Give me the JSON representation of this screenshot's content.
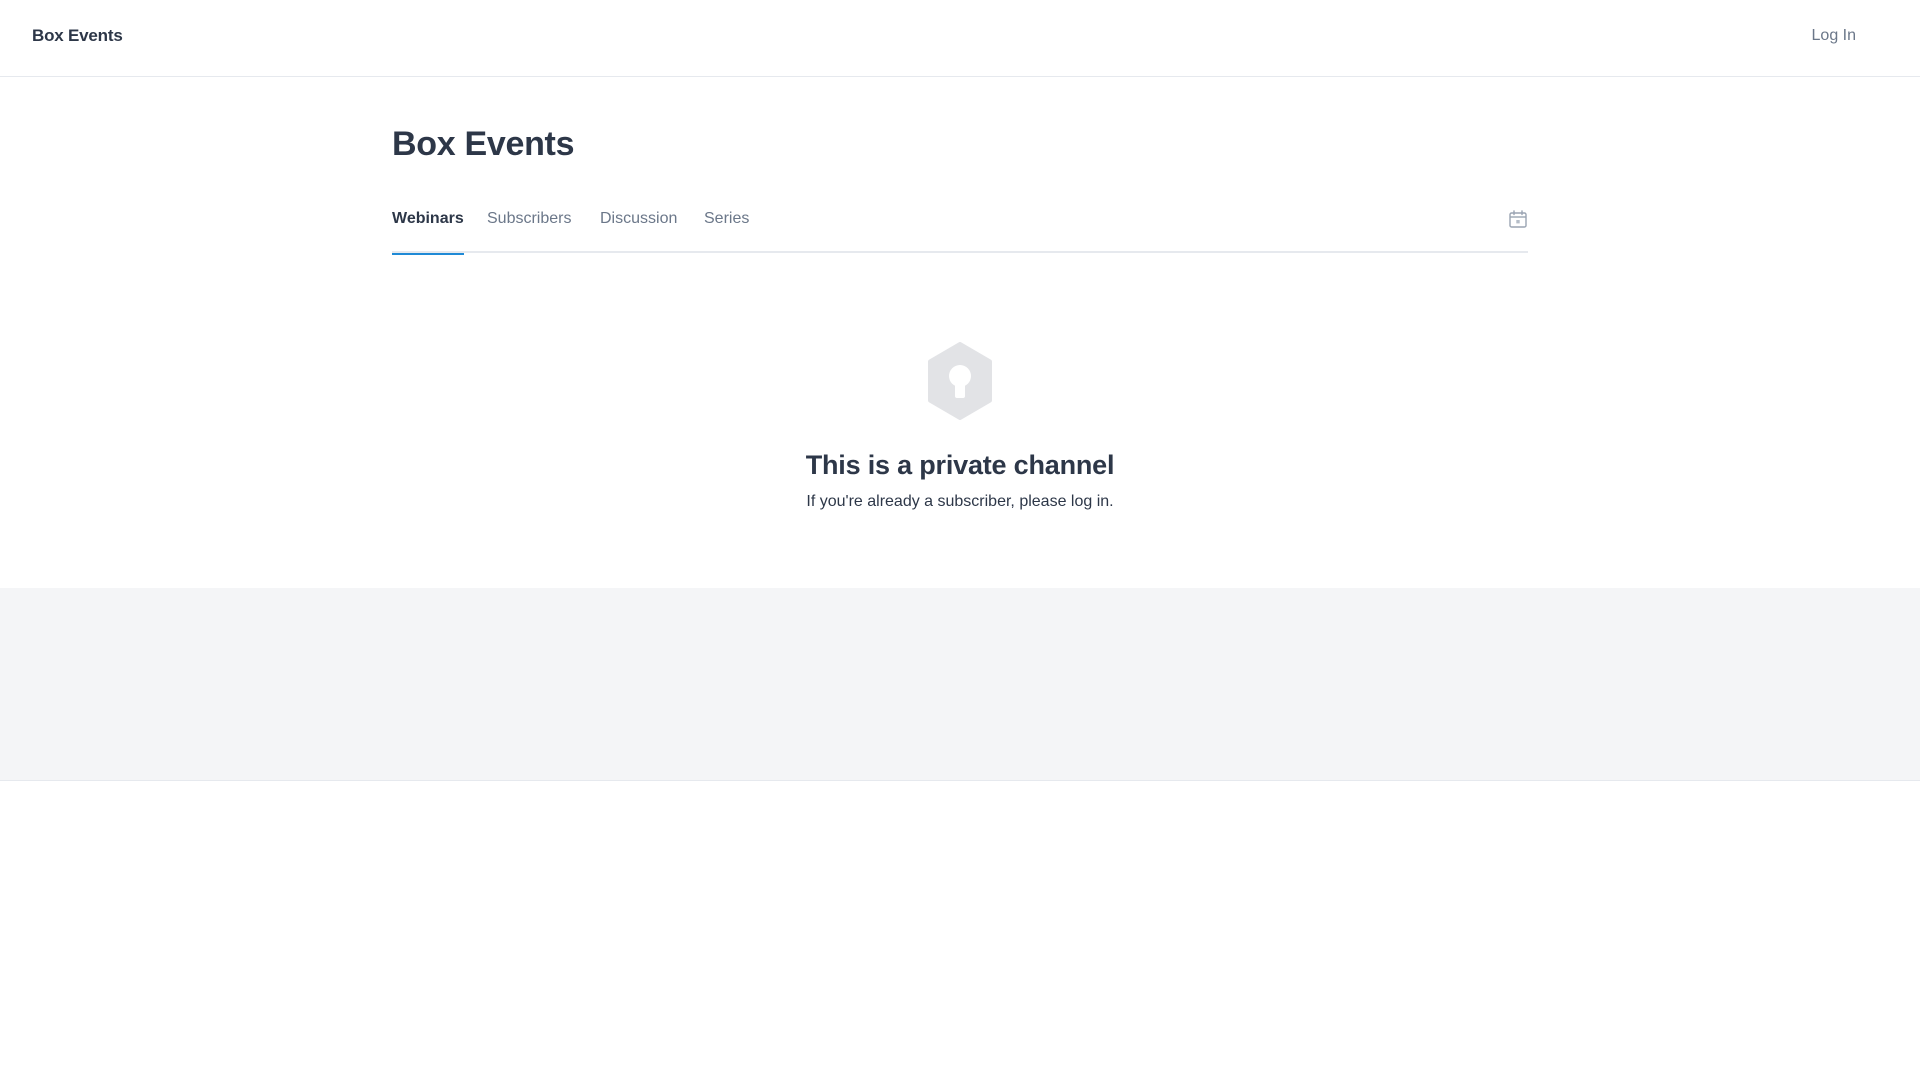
{
  "header": {
    "brand": "Box Events",
    "login_label": "Log In"
  },
  "channel": {
    "title": "Box Events",
    "tabs": [
      {
        "label": "Webinars",
        "active": true
      },
      {
        "label": "Subscribers",
        "active": false
      },
      {
        "label": "Discussion",
        "active": false
      },
      {
        "label": "Series",
        "active": false
      }
    ],
    "calendar_icon": "calendar-icon"
  },
  "empty_state": {
    "icon": "keyhole-lock-icon",
    "title": "This is a private channel",
    "subtitle": "If you're already a subscriber, please log in."
  },
  "colors": {
    "text_primary": "#2d3748",
    "text_muted": "#6b7789",
    "accent": "#1f8ad6",
    "border": "#e6e9ee",
    "footer_bg": "#f4f5f7",
    "icon_gray": "#e2e3e6"
  }
}
